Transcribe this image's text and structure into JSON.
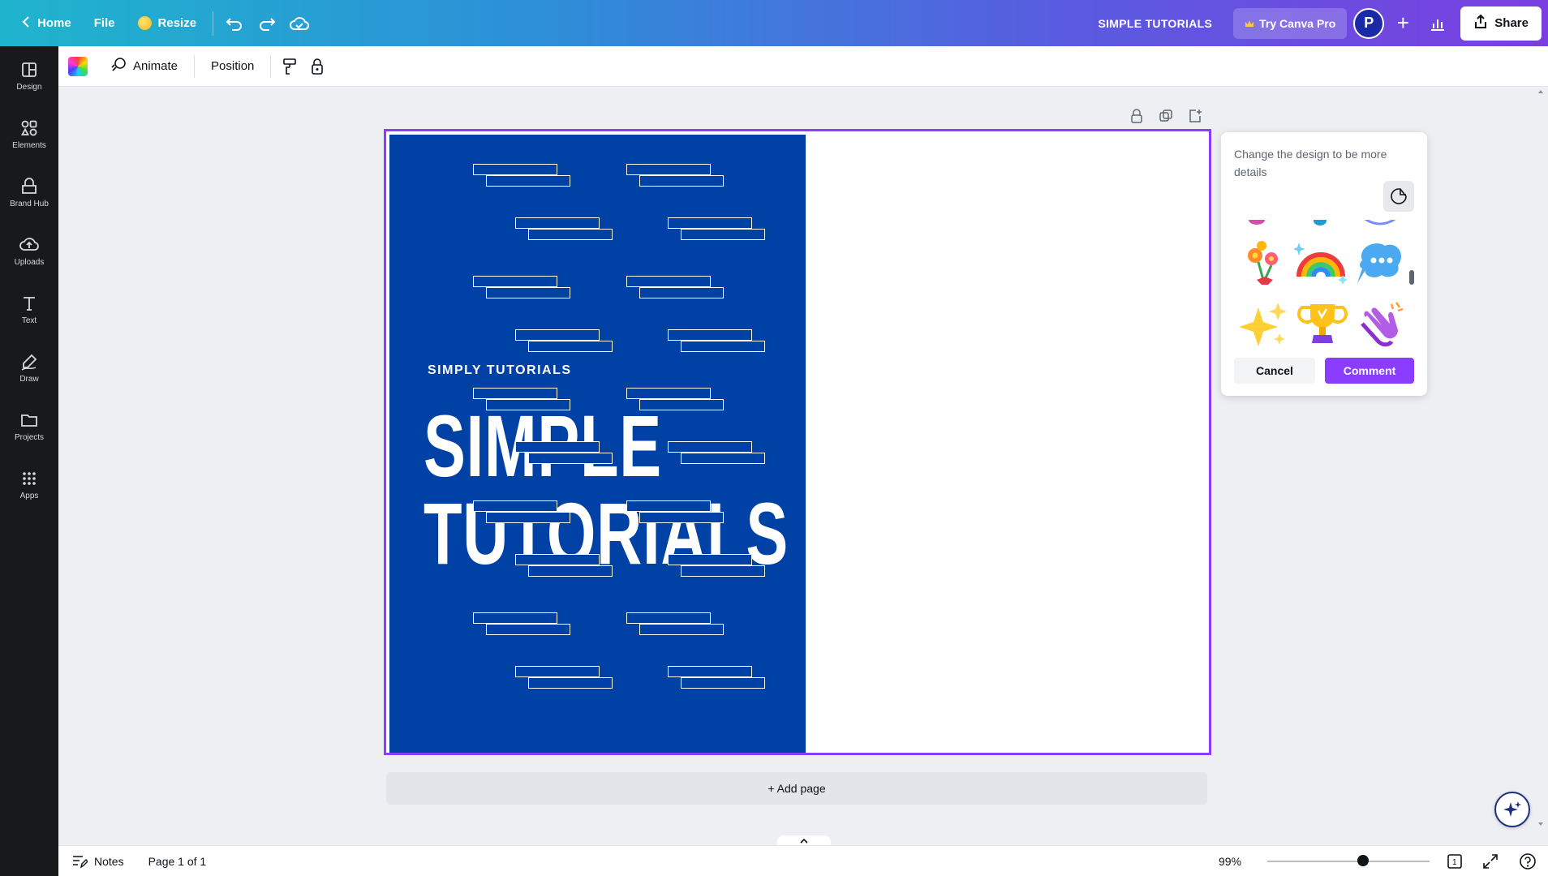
{
  "topbar": {
    "home_label": "Home",
    "file_label": "File",
    "resize_label": "Resize",
    "doc_title": "SIMPLE TUTORIALS",
    "try_pro_label": "Try Canva Pro",
    "avatar_initial": "P",
    "share_label": "Share"
  },
  "sidebar": {
    "items": [
      {
        "label": "Design",
        "icon": "design-icon"
      },
      {
        "label": "Elements",
        "icon": "elements-icon"
      },
      {
        "label": "Brand Hub",
        "icon": "brand-hub-icon"
      },
      {
        "label": "Uploads",
        "icon": "uploads-icon"
      },
      {
        "label": "Text",
        "icon": "text-icon"
      },
      {
        "label": "Draw",
        "icon": "draw-icon"
      },
      {
        "label": "Projects",
        "icon": "projects-icon"
      },
      {
        "label": "Apps",
        "icon": "apps-icon"
      }
    ]
  },
  "context_toolbar": {
    "animate_label": "Animate",
    "position_label": "Position"
  },
  "design": {
    "kicker": "SIMPLY TUTORIALS",
    "headline_line1": "SIMPLE",
    "headline_line2": "TUTORIALS",
    "accent_color": "#0041a6"
  },
  "comment_popover": {
    "text": "Change the design to be more details",
    "stickers": [
      "flowers",
      "rainbow",
      "speech-bubble",
      "sparkles",
      "trophy",
      "clapping-hands"
    ],
    "cancel_label": "Cancel",
    "comment_label": "Comment",
    "comment_color": "#8b3dff"
  },
  "add_page_label": "+ Add page",
  "bottombar": {
    "notes_label": "Notes",
    "page_label": "Page 1 of 1",
    "zoom_label": "99%",
    "zoom_level_percent": 99
  }
}
